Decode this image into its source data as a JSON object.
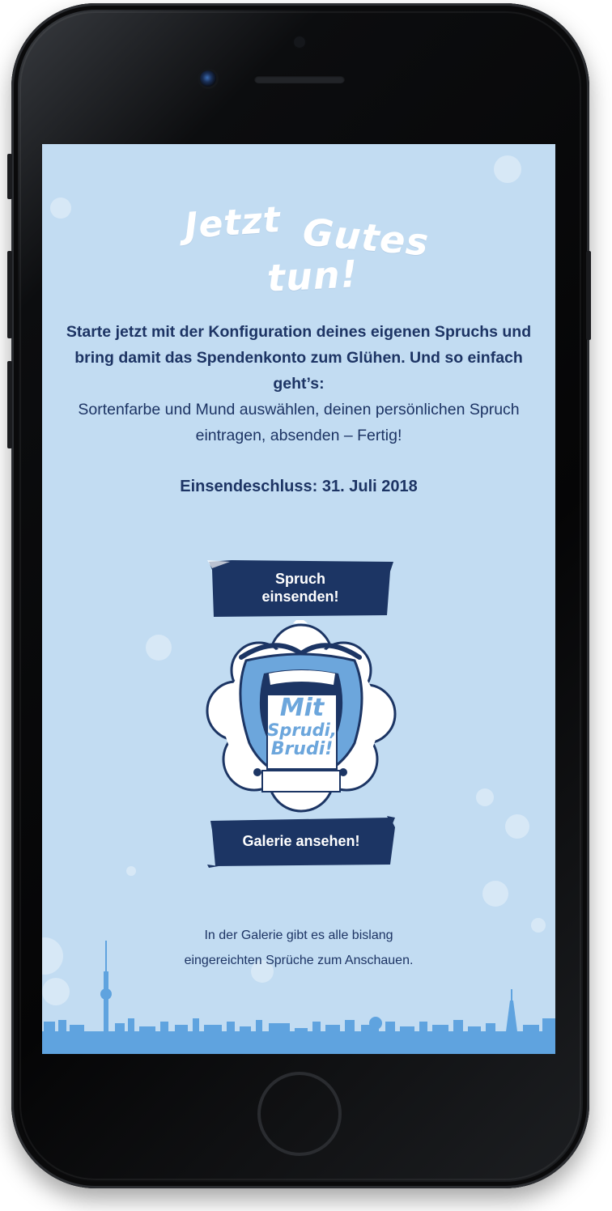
{
  "hero": {
    "title_line1": "Jetzt",
    "title_line2": "Gutes",
    "title_line3": "tun!"
  },
  "intro": {
    "bold": "Starte jetzt mit der Konfiguration deines eigenen Spruchs und bring damit das Spendenkonto zum Glühen. Und so einfach geht’s:",
    "regular": "Sortenfarbe und Mund auswählen, deinen persönlichen Spruch eintragen, absenden – Fertig!"
  },
  "deadline": "Einsendeschluss: 31. Juli 2018",
  "submit_button": {
    "line1": "Spruch",
    "line2": "einsenden!"
  },
  "mascot": {
    "line1": "Mit",
    "line2": "Sprudi,",
    "line3": "Brudi!"
  },
  "gallery_button": "Galerie ansehen!",
  "footer": {
    "line1": "In der Galerie gibt es alle bislang",
    "line2": "eingereichten Sprüche zum Anschauen."
  },
  "colors": {
    "background": "#c2dcf2",
    "text": "#1d3464",
    "banner": "#1c3564",
    "mouth": "#6ca6dc",
    "skyline": "#5fa3df"
  },
  "icons": [
    "city-skyline-icon",
    "tv-tower-icon",
    "radio-tower-icon"
  ]
}
